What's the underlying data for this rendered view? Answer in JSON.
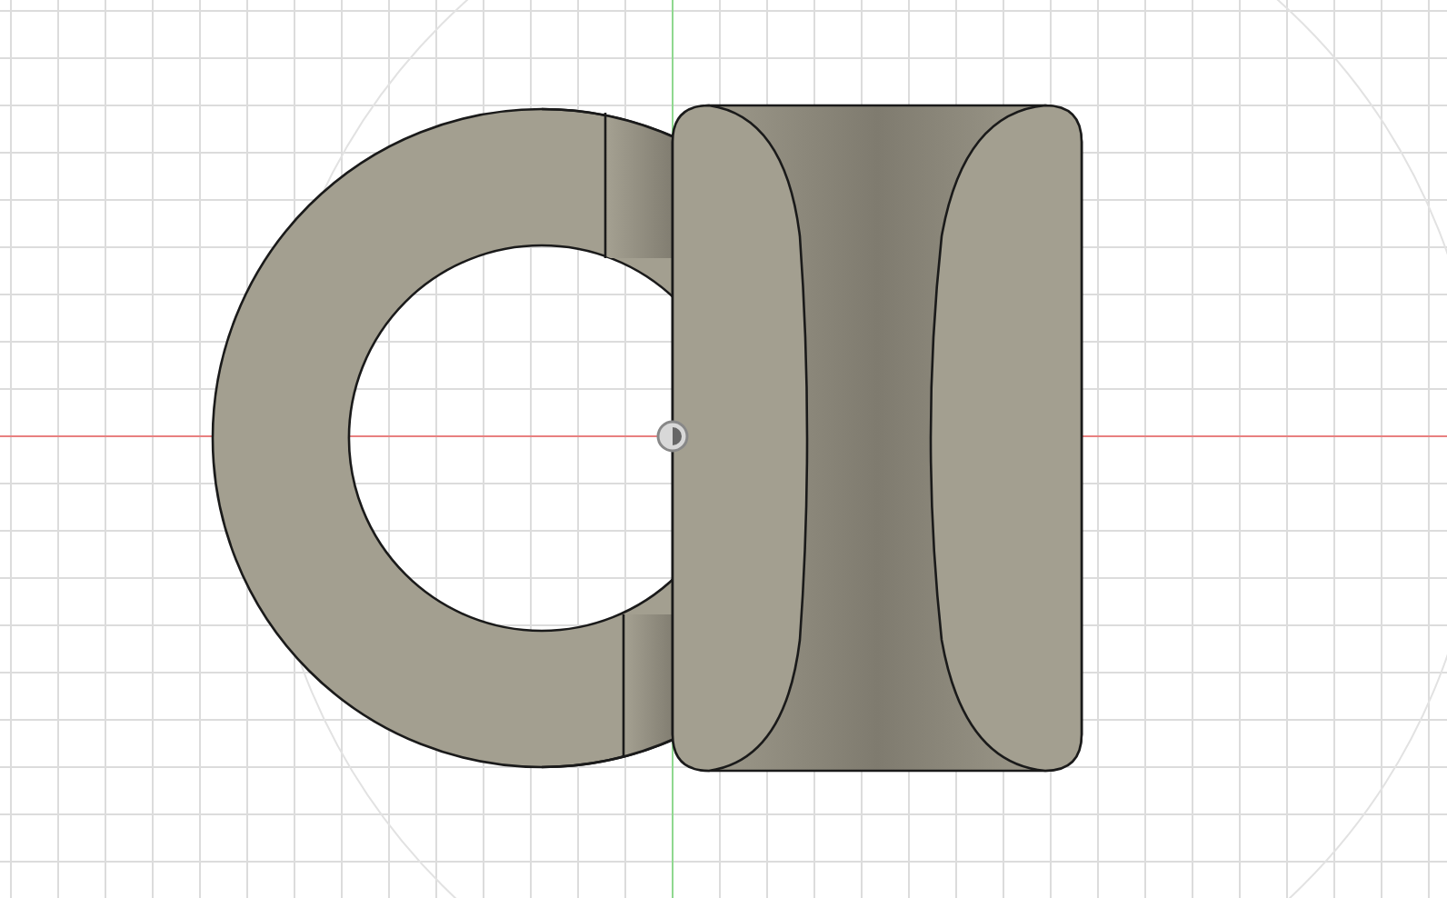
{
  "viewport": {
    "grid": true,
    "axes": true,
    "origin_marker": true
  }
}
